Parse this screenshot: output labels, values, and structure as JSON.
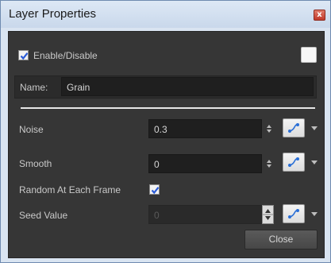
{
  "window": {
    "title": "Layer Properties",
    "close_glyph": "x"
  },
  "enable": {
    "label": "Enable/Disable",
    "checked": true
  },
  "name": {
    "label": "Name:",
    "value": "Grain"
  },
  "params": [
    {
      "label": "Noise",
      "value": "0.3",
      "enabled": true
    },
    {
      "label": "Smooth",
      "value": "0",
      "enabled": true
    },
    {
      "label": "Random At Each Frame",
      "checked": true
    },
    {
      "label": "Seed Value",
      "value": "0",
      "enabled": false
    }
  ],
  "buttons": {
    "close_label": "Close"
  },
  "colors": {
    "panel_bg": "#363636",
    "field_bg": "#1f1f1f",
    "title_bg": "#d9e4f1",
    "check_blue": "#2a5bd7",
    "function_icon": "#2a6fd6"
  }
}
